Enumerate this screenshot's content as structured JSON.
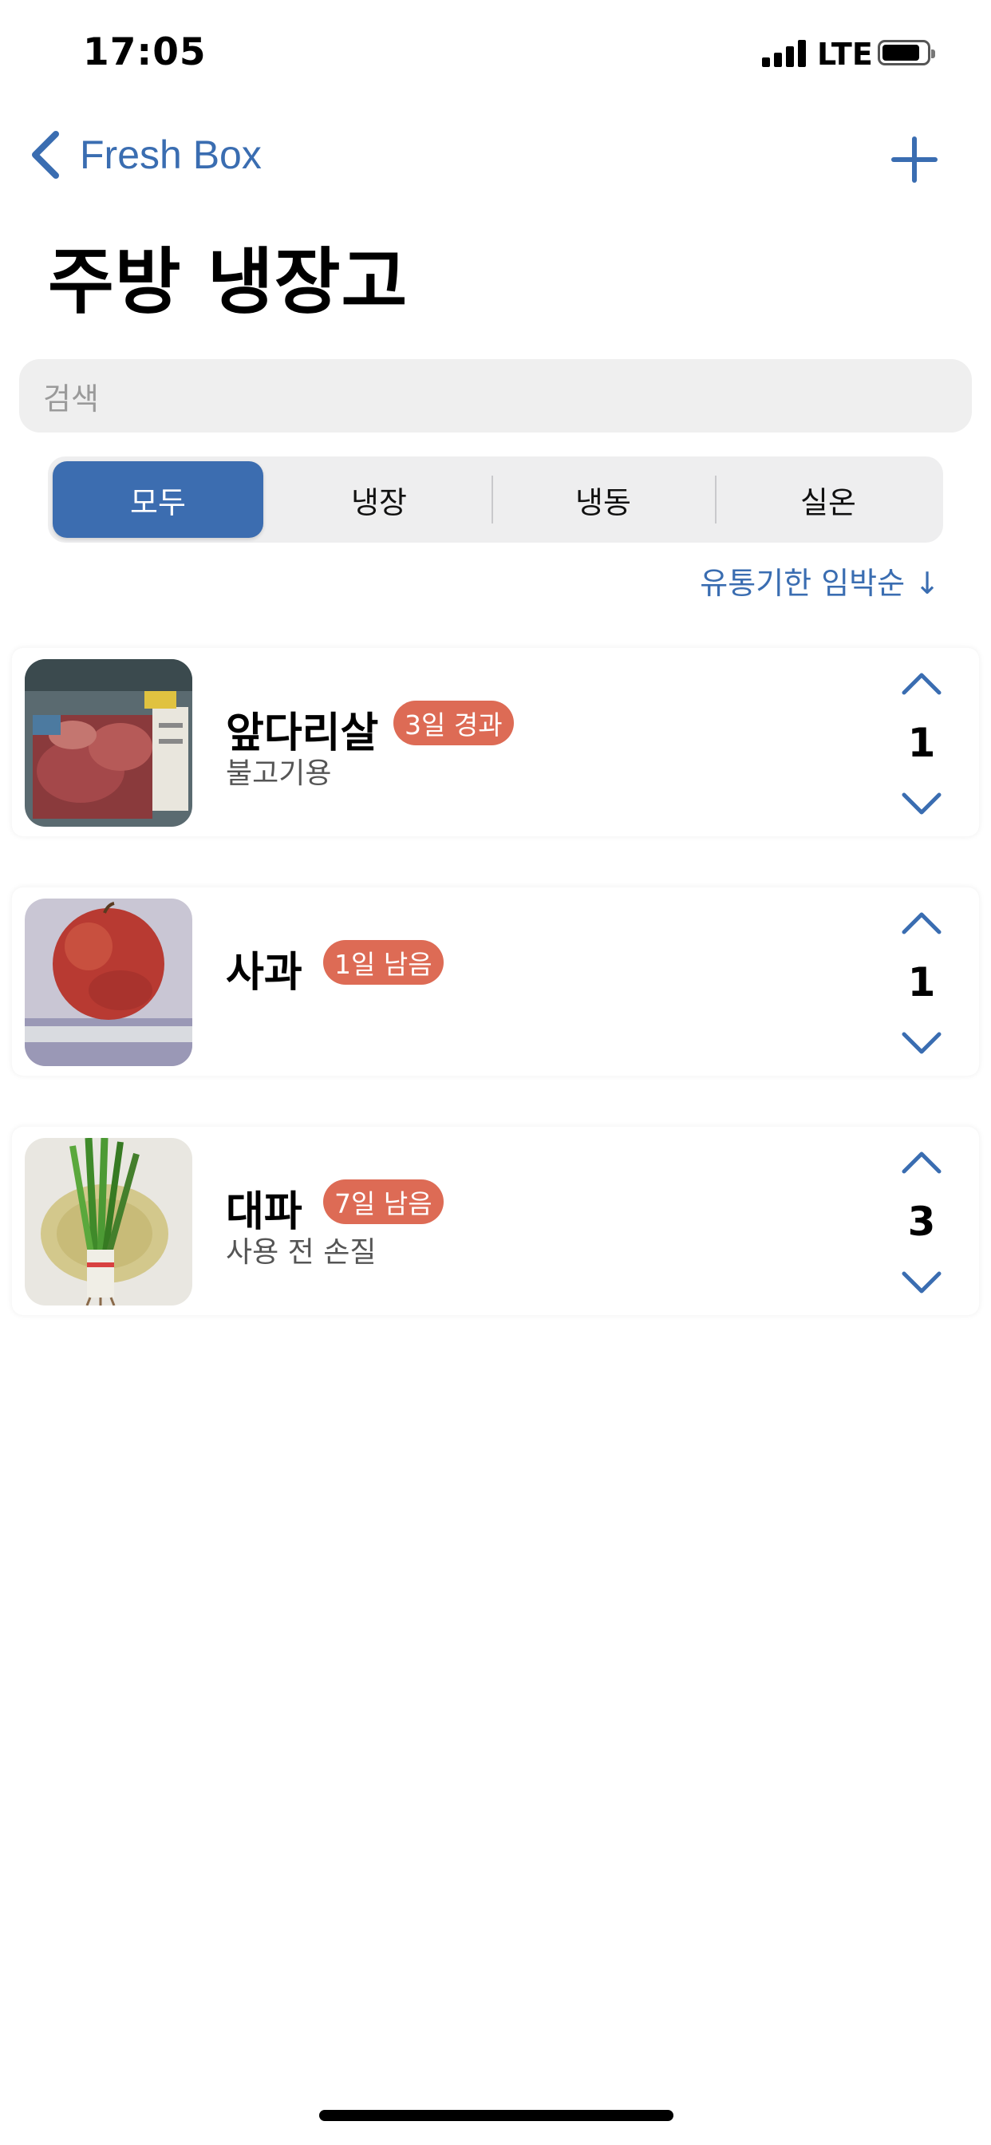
{
  "status_bar": {
    "time": "17:05",
    "network": "LTE"
  },
  "nav": {
    "back_label": "Fresh Box",
    "title": "주방 냉장고",
    "add_icon": "plus-icon",
    "back_icon": "chevron-left-icon"
  },
  "search": {
    "placeholder": "검색"
  },
  "segments": {
    "items": [
      "모두",
      "냉장",
      "냉동",
      "실온"
    ],
    "selected": "모두"
  },
  "sort": {
    "label": "유통기한 임박순 ↓"
  },
  "items": [
    {
      "name": "앞다리살",
      "badge": "3일 경과",
      "note": "불고기용",
      "quantity": "1",
      "image": "pork-meat-package"
    },
    {
      "name": "사과",
      "badge": "1일 남음",
      "note": "",
      "quantity": "1",
      "image": "red-apple"
    },
    {
      "name": "대파",
      "badge": "7일 남음",
      "note": "사용 전 손질",
      "quantity": "3",
      "image": "green-onion"
    }
  ],
  "colors": {
    "accent": "#3c6db0",
    "badge": "#dd6b55",
    "search_bg": "#efefef"
  }
}
